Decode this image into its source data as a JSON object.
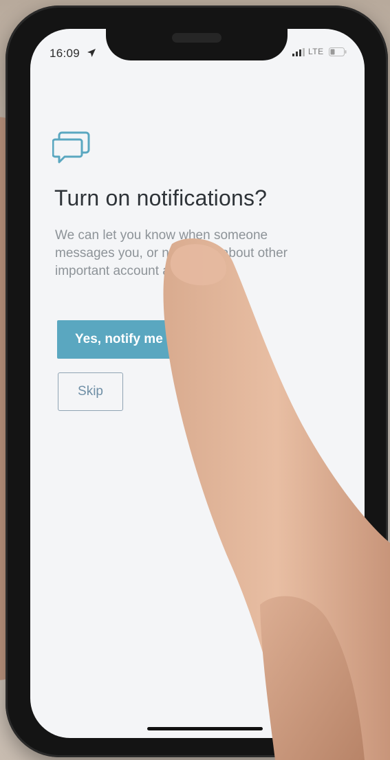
{
  "status_bar": {
    "time": "16:09",
    "location_icon": "location-arrow-icon",
    "signal_icon": "cellular-signal-icon",
    "network": "LTE",
    "battery_icon": "battery-low-icon"
  },
  "prompt": {
    "icon": "chat-bubbles-icon",
    "title": "Turn on notifications?",
    "description": "We can let you know when someone messages you, or notify you about other important account activity."
  },
  "actions": {
    "primary_label": "Yes, notify me",
    "secondary_label": "Skip"
  },
  "colors": {
    "accent": "#5aa7c0",
    "title": "#2e3338",
    "body_text": "#8d9398",
    "screen_bg": "#f4f5f7"
  }
}
